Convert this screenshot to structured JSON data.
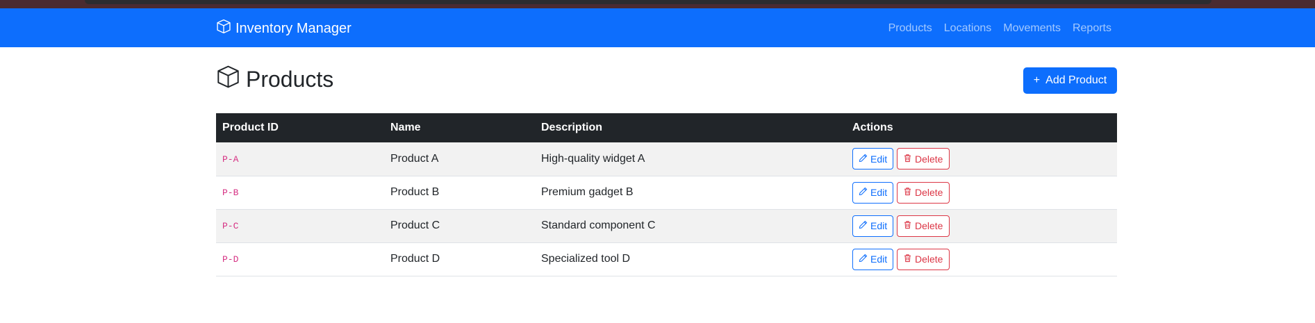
{
  "app": {
    "brand": "Inventory Manager",
    "brand_icon": "box-icon"
  },
  "nav": {
    "items": [
      {
        "label": "Products"
      },
      {
        "label": "Locations"
      },
      {
        "label": "Movements"
      },
      {
        "label": "Reports"
      }
    ]
  },
  "page": {
    "title": "Products",
    "title_icon": "box-icon",
    "add_button_label": "Add Product"
  },
  "table": {
    "headers": [
      "Product ID",
      "Name",
      "Description",
      "Actions"
    ],
    "rows": [
      {
        "id": "P-A",
        "name": "Product A",
        "description": "High-quality widget A",
        "edit": "Edit",
        "delete": "Delete"
      },
      {
        "id": "P-B",
        "name": "Product B",
        "description": "Premium gadget B",
        "edit": "Edit",
        "delete": "Delete"
      },
      {
        "id": "P-C",
        "name": "Product C",
        "description": "Standard component C",
        "edit": "Edit",
        "delete": "Delete"
      },
      {
        "id": "P-D",
        "name": "Product D",
        "description": "Specialized tool D",
        "edit": "Edit",
        "delete": "Delete"
      }
    ]
  },
  "colors": {
    "primary": "#0d6efd",
    "danger": "#dc3545",
    "table_header": "#212529",
    "code": "#d63384"
  }
}
